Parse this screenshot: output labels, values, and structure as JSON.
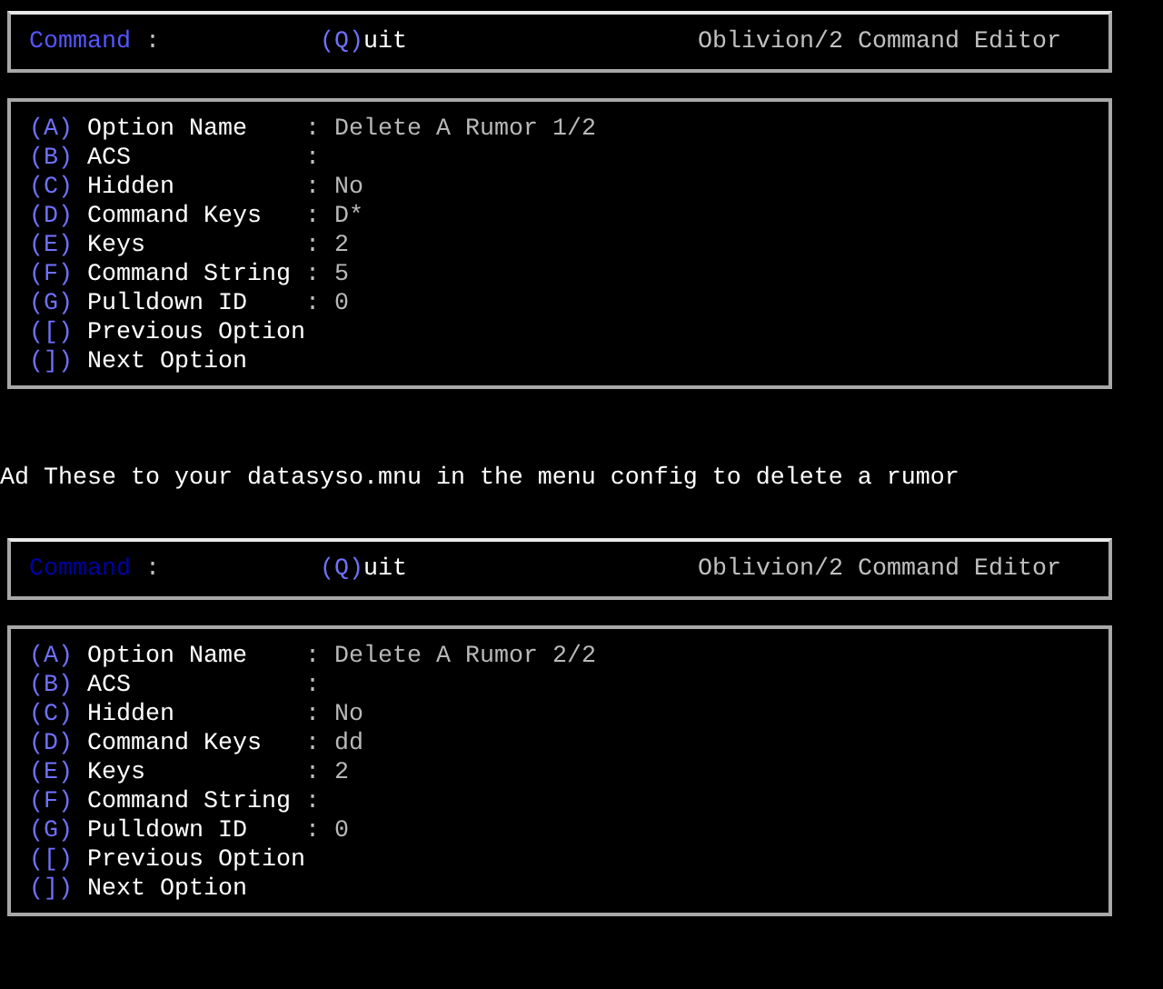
{
  "blocks": [
    {
      "kind": "screen",
      "command_bar": {
        "label": "Command",
        "separator": ":",
        "active": true,
        "quit_key": "(Q)",
        "quit_text": "uit",
        "title": "Oblivion/2 Command Editor"
      },
      "options": [
        {
          "key": "(A)",
          "label": "Option Name",
          "separator": ":",
          "value": "Delete A Rumor 1/2"
        },
        {
          "key": "(B)",
          "label": "ACS",
          "separator": ":"
        },
        {
          "key": "(C)",
          "label": "Hidden",
          "separator": ":",
          "value": "No"
        },
        {
          "key": "(D)",
          "label": "Command Keys",
          "separator": ":",
          "value": "D*"
        },
        {
          "key": "(E)",
          "label": "Keys",
          "separator": ":",
          "value": "2"
        },
        {
          "key": "(F)",
          "label": "Command String",
          "separator": ":",
          "value": "5"
        },
        {
          "key": "(G)",
          "label": "Pulldown ID",
          "separator": ":",
          "value": "0"
        },
        {
          "key": "([)",
          "label": "Previous Option"
        },
        {
          "key": "(])",
          "label": "Next Option"
        }
      ]
    },
    {
      "kind": "note",
      "text": "Ad These to your datasyso.mnu in the menu config to delete a rumor"
    },
    {
      "kind": "screen",
      "command_bar": {
        "label": "Command",
        "separator": ":",
        "active": false,
        "quit_key": "(Q)",
        "quit_text": "uit",
        "title": "Oblivion/2 Command Editor"
      },
      "options": [
        {
          "key": "(A)",
          "label": "Option Name",
          "separator": ":",
          "value": "Delete A Rumor 2/2"
        },
        {
          "key": "(B)",
          "label": "ACS",
          "separator": ":"
        },
        {
          "key": "(C)",
          "label": "Hidden",
          "separator": ":",
          "value": "No"
        },
        {
          "key": "(D)",
          "label": "Command Keys",
          "separator": ":",
          "value": "dd"
        },
        {
          "key": "(E)",
          "label": "Keys",
          "separator": ":",
          "value": "2"
        },
        {
          "key": "(F)",
          "label": "Command String",
          "separator": ":"
        },
        {
          "key": "(G)",
          "label": "Pulldown ID",
          "separator": ":",
          "value": "0"
        },
        {
          "key": "([)",
          "label": "Previous Option"
        },
        {
          "key": "(])",
          "label": "Next Option"
        }
      ]
    }
  ]
}
